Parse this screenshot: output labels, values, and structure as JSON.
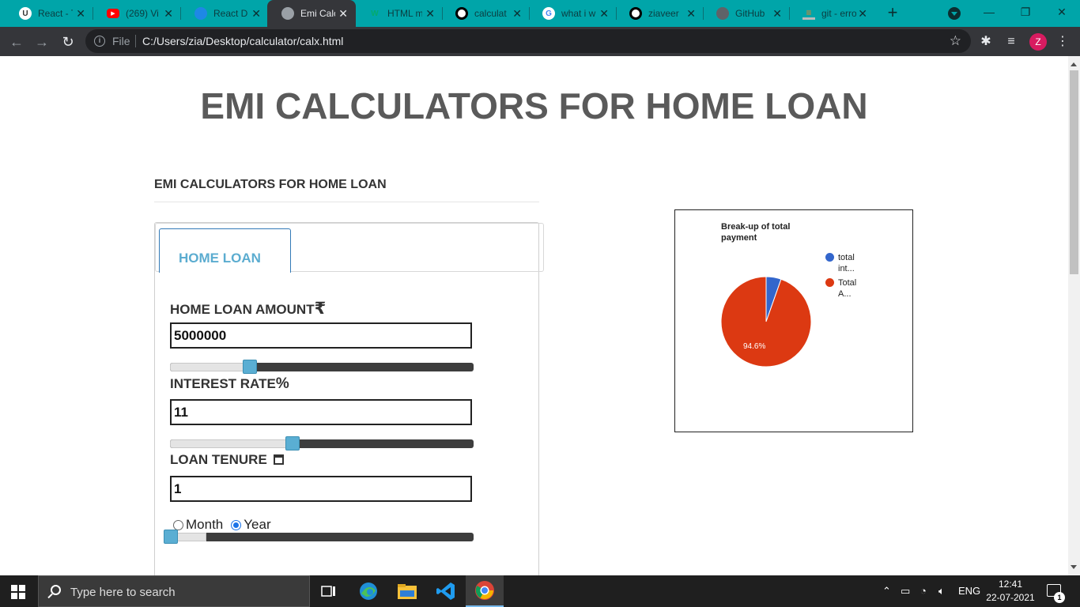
{
  "browser": {
    "tabs": [
      {
        "title": "React - T",
        "favicon": "react-badge-icon",
        "color": "#ffffff"
      },
      {
        "title": "(269) Vi",
        "favicon": "youtube-icon",
        "color": "#ff0000"
      },
      {
        "title": "React Di",
        "favicon": "react-dnd-icon",
        "color": "#1e88e5"
      },
      {
        "title": "Emi Calc",
        "favicon": "globe-icon",
        "color": "#9aa0a6",
        "active": true
      },
      {
        "title": "HTML m",
        "favicon": "w3-icon",
        "color": "#04aa6d"
      },
      {
        "title": "calculat",
        "favicon": "github-icon",
        "color": "#000000"
      },
      {
        "title": "what i w",
        "favicon": "google-icon",
        "color": "#4285f4"
      },
      {
        "title": "ziaveer",
        "favicon": "github-icon",
        "color": "#000000"
      },
      {
        "title": "GitHub",
        "favicon": "globe-icon",
        "color": "#5f6368"
      },
      {
        "title": "git - erro",
        "favicon": "stackoverflow-icon",
        "color": "#f48024"
      }
    ],
    "address": {
      "scheme_label": "File",
      "url": "C:/Users/zia/Desktop/calculator/calx.html"
    },
    "profile_initial": "Z"
  },
  "page": {
    "main_title": "EMI CALCULATORS FOR HOME LOAN",
    "sub_title": "EMI CALCULATORS FOR HOME LOAN",
    "tab_label": "HOME LOAN",
    "fields": {
      "amount": {
        "label": "HOME LOAN AMOUNT",
        "symbol": "₹",
        "value": "5000000",
        "slider_fraction": 0.25
      },
      "interest": {
        "label": "INTEREST RATE",
        "symbol": "%",
        "value": "11",
        "slider_fraction": 0.4
      },
      "tenure": {
        "label": "LOAN TENURE",
        "symbol": "calendar-icon",
        "value": "1",
        "slider_fraction": 0.0
      }
    },
    "tenure_units": [
      {
        "label": "Month",
        "checked": false
      },
      {
        "label": "Year",
        "checked": true
      }
    ],
    "colors": {
      "tab_text": "#5bacd0",
      "slider_knob": "#5aaed3"
    }
  },
  "chart_data": {
    "type": "pie",
    "title": "Break-up of total payment",
    "legend_position": "right",
    "series": [
      {
        "name": "total int...",
        "value": 5.4,
        "color": "#3366cc"
      },
      {
        "name": "Total A...",
        "value": 94.6,
        "color": "#dc3912"
      }
    ],
    "slice_labels": [
      "94.6%"
    ]
  },
  "taskbar": {
    "search_placeholder": "Type here to search",
    "language": "ENG",
    "time": "12:41",
    "date": "22-07-2021",
    "notification_count": "1"
  }
}
